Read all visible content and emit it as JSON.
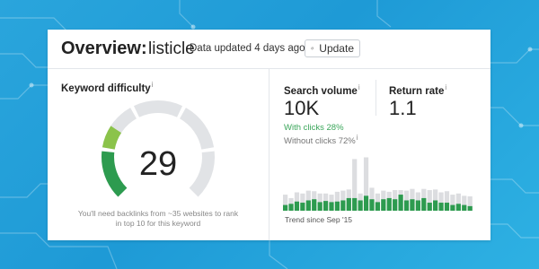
{
  "header": {
    "title": "Overview:",
    "keyword": "listicle",
    "updated_text": "Data updated 4 days ago",
    "update_button_label": "Update"
  },
  "keyword_difficulty": {
    "label": "Keyword difficulty",
    "info_icon": "i",
    "value": "29",
    "score": 29,
    "max_score": 100,
    "note": "You'll need backlinks from ~35 websites to rank in top 10 for this keyword",
    "colors": {
      "fill_dark": "#2d9b4f",
      "fill_light": "#8bc34a",
      "track": "#e1e3e6"
    }
  },
  "search_volume": {
    "label": "Search volume",
    "info_icon": "i",
    "value": "10K",
    "with_clicks": "With clicks 28%",
    "without_clicks": "Without clicks 72%",
    "without_clicks_info_icon": "i"
  },
  "return_rate": {
    "label": "Return rate",
    "info_icon": "i",
    "value": "1.1"
  },
  "trend": {
    "label": "Trend since Sep '15",
    "colors": {
      "total": "#dcdde0",
      "with_clicks": "#2d9b4f"
    },
    "chart_data": {
      "type": "bar",
      "series": [
        {
          "values": [
            0.28,
            0.22,
            0.32,
            0.3,
            0.35,
            0.34,
            0.3,
            0.3,
            0.28,
            0.33,
            0.35,
            0.37,
            0.9,
            0.3,
            0.93,
            0.4,
            0.3,
            0.35,
            0.33,
            0.36,
            0.36,
            0.35,
            0.38,
            0.32,
            0.38,
            0.36,
            0.37,
            0.32,
            0.34,
            0.28,
            0.3,
            0.26,
            0.25
          ]
        },
        {
          "values": [
            0.1,
            0.12,
            0.16,
            0.14,
            0.18,
            0.2,
            0.15,
            0.17,
            0.15,
            0.16,
            0.18,
            0.22,
            0.22,
            0.18,
            0.26,
            0.2,
            0.15,
            0.2,
            0.22,
            0.2,
            0.28,
            0.18,
            0.2,
            0.18,
            0.22,
            0.14,
            0.18,
            0.14,
            0.14,
            0.1,
            0.12,
            0.1,
            0.08
          ]
        }
      ]
    }
  }
}
